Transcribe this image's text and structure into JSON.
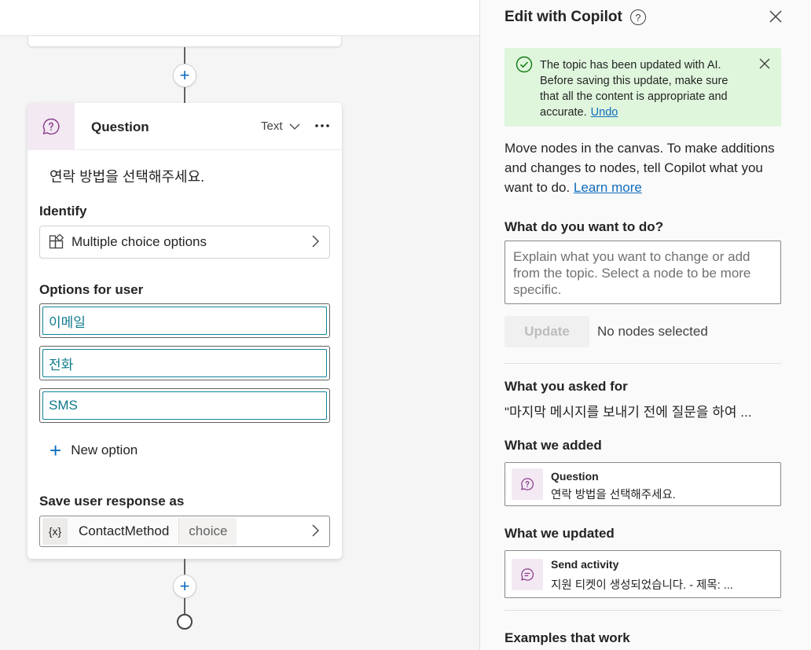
{
  "canvas": {
    "question_node": {
      "title": "Question",
      "response_type": "Text",
      "message": "연락 방법을 선택해주세요.",
      "identify_label": "Identify",
      "identify_value": "Multiple choice options",
      "options_label": "Options for user",
      "options": [
        "이메일",
        "전화",
        "SMS"
      ],
      "new_option_label": "New option",
      "save_label": "Save user response as",
      "variable_icon": "{x}",
      "variable_name": "ContactMethod",
      "variable_type": "choice"
    },
    "add_node_symbol": "+"
  },
  "panel": {
    "title": "Edit with Copilot",
    "help_symbol": "?",
    "banner": {
      "message": "The topic has been updated with AI. Before saving this update, make sure that all the content is appropriate and accurate.",
      "undo_label": "Undo",
      "color": "#dff6dd"
    },
    "intro_text": "Move nodes in the canvas. To make additions and changes to nodes, tell Copilot what you want to do.",
    "learn_more_label": "Learn more",
    "what_label": "What do you want to do?",
    "input_placeholder": "Explain what you want to change or add from the topic. Select a node to be more specific.",
    "update_label": "Update",
    "no_nodes_label": "No nodes selected",
    "asked_label": "What you asked for",
    "asked_text": "\"마지막 메시지를 보내기 전에 질문을 하여 ...",
    "added_label": "What we added",
    "added_node": {
      "title": "Question",
      "subtitle": "연락 방법을 선택해주세요."
    },
    "updated_label": "What we updated",
    "updated_node": {
      "title": "Send activity",
      "subtitle": "지원 티켓이 생성되었습니다. - 제목: ..."
    },
    "examples_label": "Examples that work"
  },
  "colors": {
    "accent": "#0f6cbd",
    "node_icon_bg": "#f3e9f3",
    "node_icon": "#8a3a8a",
    "success": "#107c10"
  }
}
